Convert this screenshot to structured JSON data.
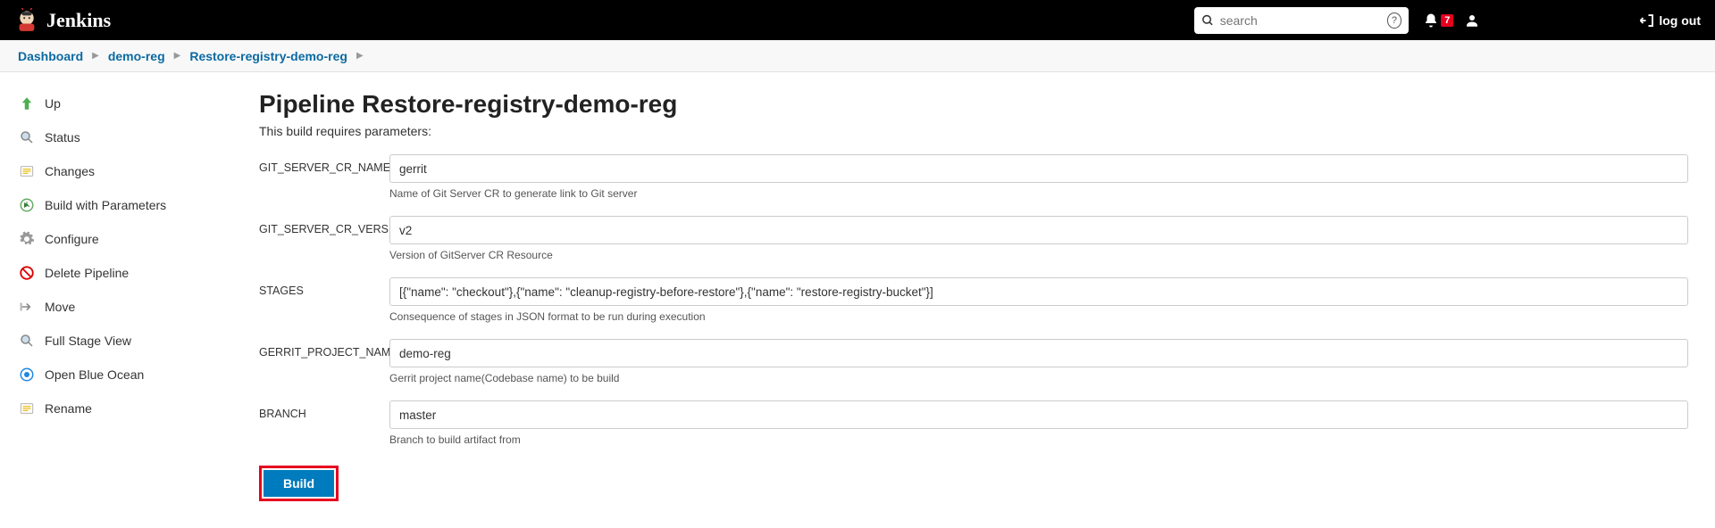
{
  "header": {
    "product": "Jenkins",
    "search_placeholder": "search",
    "notifications_count": "7",
    "logout_label": "log out"
  },
  "breadcrumbs": [
    "Dashboard",
    "demo-reg",
    "Restore-registry-demo-reg"
  ],
  "sidebar": {
    "items": [
      {
        "label": "Up"
      },
      {
        "label": "Status"
      },
      {
        "label": "Changes"
      },
      {
        "label": "Build with Parameters"
      },
      {
        "label": "Configure"
      },
      {
        "label": "Delete Pipeline"
      },
      {
        "label": "Move"
      },
      {
        "label": "Full Stage View"
      },
      {
        "label": "Open Blue Ocean"
      },
      {
        "label": "Rename"
      }
    ]
  },
  "page": {
    "title": "Pipeline Restore-registry-demo-reg",
    "subtitle": "This build requires parameters:",
    "build_label": "Build"
  },
  "parameters": [
    {
      "name": "GIT_SERVER_CR_NAME",
      "value": "gerrit",
      "help": "Name of Git Server CR to generate link to Git server"
    },
    {
      "name": "GIT_SERVER_CR_VERSION",
      "value": "v2",
      "help": "Version of GitServer CR Resource"
    },
    {
      "name": "STAGES",
      "value": "[{\"name\": \"checkout\"},{\"name\": \"cleanup-registry-before-restore\"},{\"name\": \"restore-registry-bucket\"}]",
      "help": "Consequence of stages in JSON format to be run during execution"
    },
    {
      "name": "GERRIT_PROJECT_NAME",
      "value": "demo-reg",
      "help": "Gerrit project name(Codebase name) to be build"
    },
    {
      "name": "BRANCH",
      "value": "master",
      "help": "Branch to build artifact from"
    }
  ]
}
